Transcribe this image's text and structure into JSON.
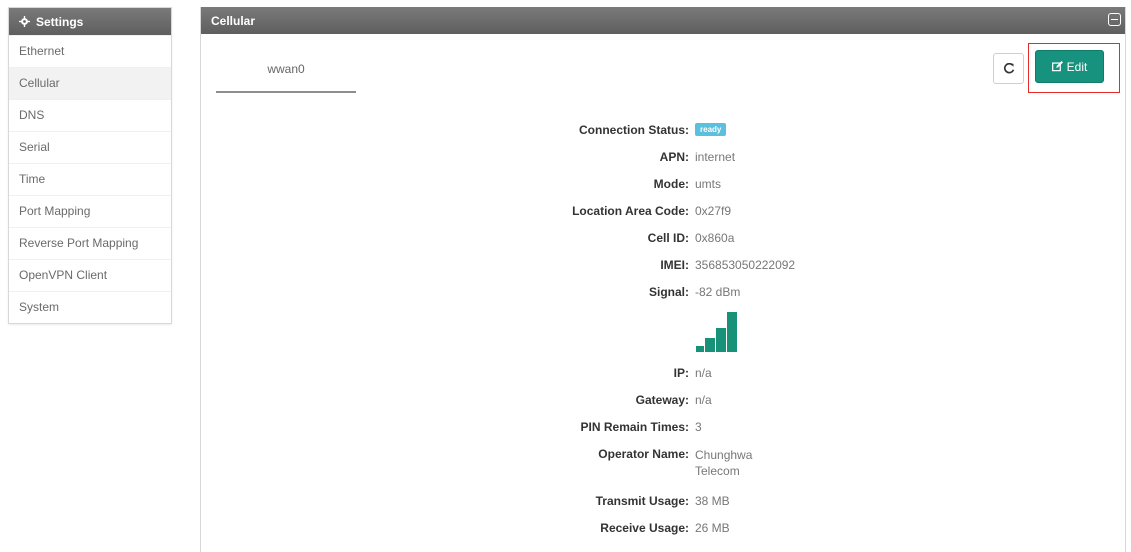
{
  "sidebar": {
    "title": "Settings",
    "items": [
      {
        "label": "Ethernet",
        "active": false
      },
      {
        "label": "Cellular",
        "active": true
      },
      {
        "label": "DNS",
        "active": false
      },
      {
        "label": "Serial",
        "active": false
      },
      {
        "label": "Time",
        "active": false
      },
      {
        "label": "Port Mapping",
        "active": false
      },
      {
        "label": "Reverse Port Mapping",
        "active": false
      },
      {
        "label": "OpenVPN Client",
        "active": false
      },
      {
        "label": "System",
        "active": false
      }
    ]
  },
  "panel": {
    "title": "Cellular",
    "tab": "wwan0",
    "edit_label": "Edit"
  },
  "info": {
    "connection_status": {
      "label": "Connection Status:",
      "value": "ready"
    },
    "apn": {
      "label": "APN:",
      "value": "internet"
    },
    "mode": {
      "label": "Mode:",
      "value": "umts"
    },
    "lac": {
      "label": "Location Area Code:",
      "value": "0x27f9"
    },
    "cell_id": {
      "label": "Cell ID:",
      "value": "0x860a"
    },
    "imei": {
      "label": "IMEI:",
      "value": "356853050222092"
    },
    "signal": {
      "label": "Signal:",
      "value": "-82 dBm",
      "bars": 4
    },
    "ip": {
      "label": "IP:",
      "value": "n/a"
    },
    "gateway": {
      "label": "Gateway:",
      "value": "n/a"
    },
    "pin_remain": {
      "label": "PIN Remain Times:",
      "value": "3"
    },
    "operator": {
      "label": "Operator Name:",
      "value": "Chunghwa Telecom"
    },
    "transmit": {
      "label": "Transmit Usage:",
      "value": "38 MB"
    },
    "receive": {
      "label": "Receive Usage:",
      "value": "26 MB"
    }
  },
  "colors": {
    "accent": "#17927e",
    "badge": "#5bc0de",
    "header": "#6b6b6b",
    "highlight": "#e52a2a"
  }
}
